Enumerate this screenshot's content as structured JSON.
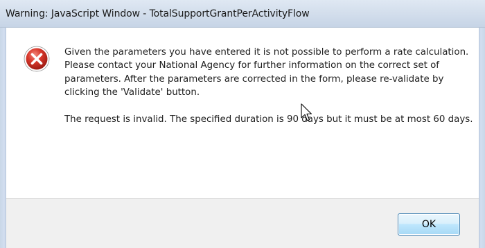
{
  "dialog": {
    "title": "Warning: JavaScript Window - TotalSupportGrantPerActivityFlow",
    "icon": "error-icon",
    "message_paragraphs": [
      "Given the parameters you have entered it is not possible to perform a rate calculation. Please contact your National Agency for further information on the correct set of parameters. After the parameters are corrected in the form, please re-validate by clicking the 'Validate' button.",
      "The request is invalid. The specified duration is 90 days but it must be at most 60 days."
    ],
    "ok_label": "OK"
  },
  "colors": {
    "error_red": "#d4281f",
    "button_border": "#3c7fb1"
  }
}
